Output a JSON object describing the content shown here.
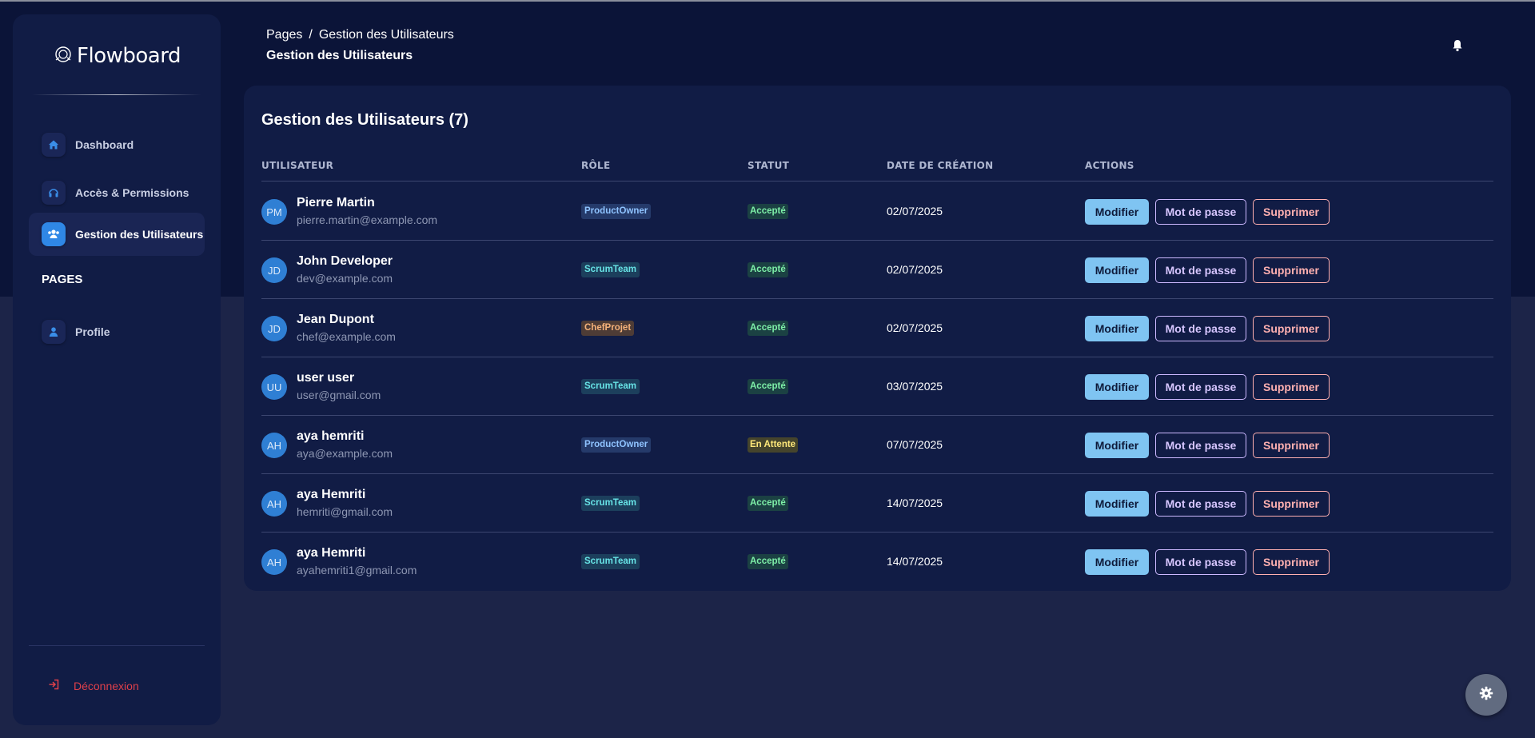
{
  "sidebar": {
    "brand": "Flowboard",
    "items": [
      {
        "label": "Dashboard",
        "icon": "home-icon"
      },
      {
        "label": "Accès & Permissions",
        "icon": "headset-icon"
      },
      {
        "label": "Gestion des Utilisateurs",
        "icon": "users-icon",
        "active": true
      }
    ],
    "section_title": "PAGES",
    "pages": [
      {
        "label": "Profile",
        "icon": "user-icon"
      }
    ],
    "logout_label": "Déconnexion"
  },
  "header": {
    "breadcrumb_root": "Pages",
    "breadcrumb_sep": "/",
    "breadcrumb_current": "Gestion des Utilisateurs",
    "title": "Gestion des Utilisateurs"
  },
  "card": {
    "title": "Gestion des Utilisateurs (7)",
    "columns": [
      "UTILISATEUR",
      "RÔLE",
      "STATUT",
      "DATE DE CRÉATION",
      "ACTIONS"
    ],
    "actions": {
      "edit": "Modifier",
      "password": "Mot de passe",
      "delete": "Supprimer"
    },
    "users": [
      {
        "initials": "PM",
        "name": "Pierre Martin",
        "email": "pierre.martin@example.com",
        "role": "ProductOwner",
        "status": "Accepté",
        "date": "02/07/2025"
      },
      {
        "initials": "JD",
        "name": "John Developer",
        "email": "dev@example.com",
        "role": "ScrumTeam",
        "status": "Accepté",
        "date": "02/07/2025"
      },
      {
        "initials": "JD",
        "name": "Jean Dupont",
        "email": "chef@example.com",
        "role": "ChefProjet",
        "status": "Accepté",
        "date": "02/07/2025"
      },
      {
        "initials": "UU",
        "name": "user user",
        "email": "user@gmail.com",
        "role": "ScrumTeam",
        "status": "Accepté",
        "date": "03/07/2025"
      },
      {
        "initials": "AH",
        "name": "aya hemriti",
        "email": "aya@example.com",
        "role": "ProductOwner",
        "status": "En Attente",
        "date": "07/07/2025"
      },
      {
        "initials": "AH",
        "name": "aya Hemriti",
        "email": "hemriti@gmail.com",
        "role": "ScrumTeam",
        "status": "Accepté",
        "date": "14/07/2025"
      },
      {
        "initials": "AH",
        "name": "aya Hemriti",
        "email": "ayahemriti1@gmail.com",
        "role": "ScrumTeam",
        "status": "Accepté",
        "date": "14/07/2025"
      }
    ]
  },
  "colors": {
    "accent": "#2f87e6",
    "danger": "#e0404a",
    "background_top": "#0b1438",
    "background": "#1c2448",
    "card": "#111c45"
  },
  "icons": {
    "notification": "bell-icon",
    "settings": "gear-icon",
    "logout": "logout-icon"
  }
}
